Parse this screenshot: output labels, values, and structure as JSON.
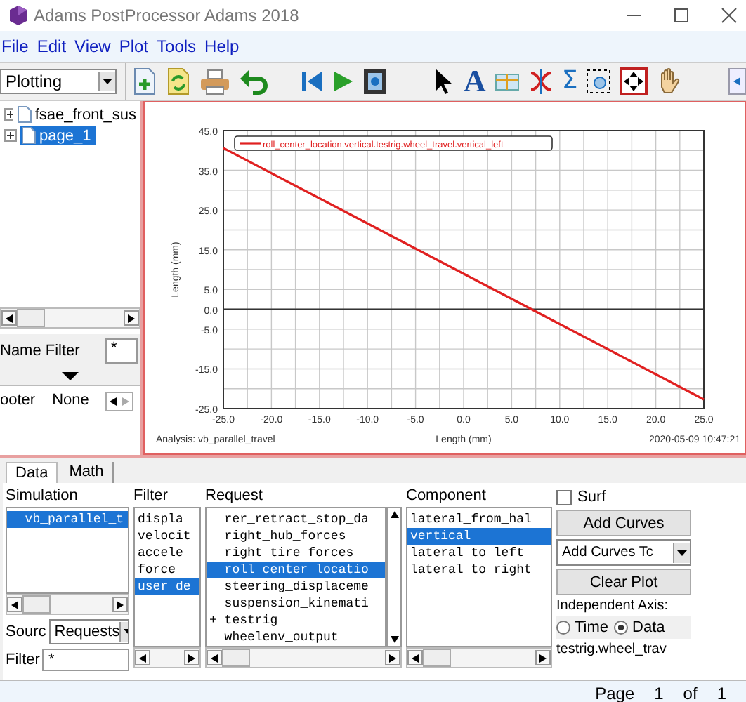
{
  "window": {
    "title": "Adams PostProcessor Adams 2018"
  },
  "menu": [
    "File",
    "Edit",
    "View",
    "Plot",
    "Tools",
    "Help"
  ],
  "mode_select": {
    "value": "Plotting"
  },
  "toolbar": {
    "text_glyph": "A",
    "sum_glyph": "Σ"
  },
  "tree": [
    {
      "label": "fsae_front_sus",
      "selected": false
    },
    {
      "label": "page_1",
      "selected": true
    }
  ],
  "name_filter": {
    "label": "Name Filter",
    "value": "*"
  },
  "footer_row": {
    "label": "ooter",
    "value": "None"
  },
  "plot": {
    "chart_data": {
      "type": "line",
      "grid": true,
      "xlabel": "Length (mm)",
      "ylabel": "Length (mm)",
      "x": [
        -25,
        25
      ],
      "series": [
        {
          "name": "roll_center_location.vertical.testrig.wheel_travel.vertical_left",
          "color": "#e02020",
          "values": [
            40.6,
            -22.7
          ]
        }
      ],
      "xlim": [
        -25,
        25
      ],
      "ylim": [
        -25,
        45
      ],
      "xticks": [
        {
          "value": -25,
          "label": "-25.0"
        },
        {
          "value": -20,
          "label": "-20.0"
        },
        {
          "value": -15,
          "label": "-15.0"
        },
        {
          "value": -10,
          "label": "-10.0"
        },
        {
          "value": -5,
          "label": "-5.0"
        },
        {
          "value": 0,
          "label": "0.0"
        },
        {
          "value": 5,
          "label": "5.0"
        },
        {
          "value": 10,
          "label": "10.0"
        },
        {
          "value": 15,
          "label": "15.0"
        },
        {
          "value": 20,
          "label": "20.0"
        },
        {
          "value": 25,
          "label": "25.0"
        }
      ],
      "yticks": [
        {
          "value": -25,
          "label": "-25.0"
        },
        {
          "value": -15,
          "label": "-15.0"
        },
        {
          "value": -5,
          "label": "-5.0"
        },
        {
          "value": 0,
          "label": "0.0"
        },
        {
          "value": 5,
          "label": "5.0"
        },
        {
          "value": 15,
          "label": "15.0"
        },
        {
          "value": 25,
          "label": "25.0"
        },
        {
          "value": 35,
          "label": "35.0"
        },
        {
          "value": 45,
          "label": "45.0"
        }
      ]
    },
    "analysis": "Analysis:  vb_parallel_travel",
    "timestamp": "2020-05-09 10:47:21"
  },
  "tabs": [
    {
      "label": "Data",
      "selected": true
    },
    {
      "label": "Math",
      "selected": false
    }
  ],
  "simulation": {
    "label": "Simulation",
    "items": [
      {
        "label": "vb_parallel_t",
        "selected": true
      }
    ]
  },
  "filter_list": {
    "label": "Filter",
    "items": [
      {
        "label": "displa",
        "selected": false
      },
      {
        "label": "velocit",
        "selected": false
      },
      {
        "label": "accele",
        "selected": false
      },
      {
        "label": "force",
        "selected": false
      },
      {
        "label": "user de",
        "selected": true
      }
    ]
  },
  "request": {
    "label": "Request",
    "items": [
      {
        "label": "rer_retract_stop_da",
        "selected": false
      },
      {
        "label": "right_hub_forces",
        "selected": false
      },
      {
        "label": "right_tire_forces",
        "selected": false
      },
      {
        "label": "roll_center_locatio",
        "selected": true
      },
      {
        "label": "steering_displaceme",
        "selected": false
      },
      {
        "label": "suspension_kinemati",
        "selected": false
      },
      {
        "label": "testrig",
        "selected": false,
        "prefix": "+"
      },
      {
        "label": "wheelenv_output",
        "selected": false
      }
    ]
  },
  "component": {
    "label": "Component",
    "items": [
      {
        "label": "lateral_from_hal",
        "selected": false
      },
      {
        "label": "vertical",
        "selected": true
      },
      {
        "label": "lateral_to_left_",
        "selected": false
      },
      {
        "label": "lateral_to_right_",
        "selected": false
      }
    ]
  },
  "surf": {
    "label": "Surf",
    "checked": false
  },
  "source": {
    "label": "Sourc",
    "value": "Requests"
  },
  "filter_field": {
    "label": "Filter",
    "value": "*"
  },
  "buttons": {
    "add": "Add Curves",
    "add_to": "Add Curves Tc",
    "clear": "Clear Plot"
  },
  "independent_axis": {
    "label": "Independent Axis:",
    "options": [
      {
        "label": "Time",
        "selected": false
      },
      {
        "label": "Data",
        "selected": true
      }
    ]
  },
  "curve_name": "testrig.wheel_trav",
  "status": {
    "page": "Page",
    "current": "1",
    "of": "of",
    "total": "1"
  }
}
